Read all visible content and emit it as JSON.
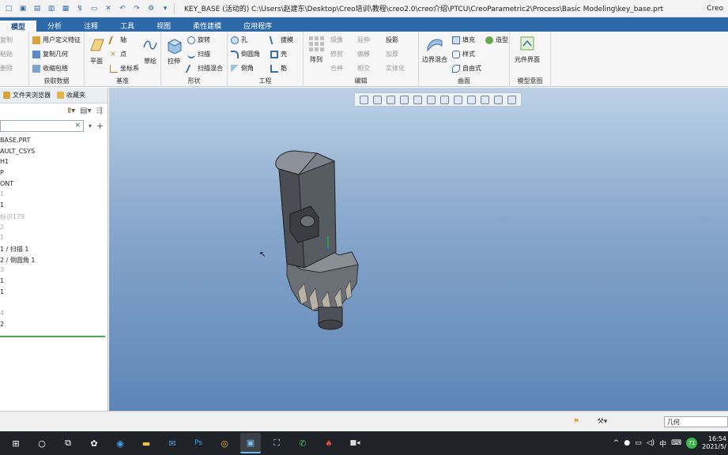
{
  "window": {
    "title": "KEY_BASE (活动的) C:\\Users\\赵建东\\Desktop\\Creo培训\\教程\\creo2.0\\creo介绍\\PTCU\\CreoParametric2\\Process\\Basic Modeling\\key_base.prt",
    "app_name": "Creo"
  },
  "tabs": [
    {
      "label": "模型",
      "active": true
    },
    {
      "label": "分析",
      "active": false
    },
    {
      "label": "注释",
      "active": false
    },
    {
      "label": "工具",
      "active": false
    },
    {
      "label": "视图",
      "active": false
    },
    {
      "label": "柔性建模",
      "active": false
    },
    {
      "label": "应用程序",
      "active": false
    }
  ],
  "ribbon": {
    "ops": {
      "copy": "复制",
      "paste": "粘贴",
      "delete": "删除"
    },
    "get_data": {
      "udf": "用户定义特征",
      "copy_geom": "复制几何",
      "shrinkwrap": "收缩包络",
      "title": "获取数据"
    },
    "datum": {
      "plane": "平面",
      "axis": "轴",
      "point": "点",
      "csys": "坐标系",
      "sketch": "草绘",
      "title": "基准"
    },
    "shapes": {
      "extrude": "拉伸",
      "revolve": "旋转",
      "sweep": "扫描",
      "swept_blend": "扫描混合",
      "title": "形状"
    },
    "engineering": {
      "hole": "孔",
      "round": "倒圆角",
      "chamfer": "倒角",
      "draft": "拔模",
      "shell": "壳",
      "rib": "筋",
      "title": "工程"
    },
    "editing": {
      "pattern": "阵列",
      "mirror": "镜像",
      "trim": "修剪",
      "merge": "合并",
      "extend": "延伸",
      "offset": "偏移",
      "intersect": "相交",
      "project": "投影",
      "thicken": "加厚",
      "solidify": "实体化",
      "title": "编辑"
    },
    "surfaces": {
      "boundary_blend": "边界混合",
      "fill": "填充",
      "style": "样式",
      "freestyle": "自由式",
      "title": "曲面"
    },
    "model_intent": {
      "component_interface": "元件界面",
      "title": "模型意图"
    }
  },
  "left_panel": {
    "tab_browser": "文件夹浏览器",
    "tab_favorites": "收藏夹",
    "tree": [
      {
        "text": "BASE.PRT",
        "dim": false
      },
      {
        "text": "AULT_CSYS",
        "dim": false
      },
      {
        "text": "H1",
        "dim": false
      },
      {
        "text": "P",
        "dim": false
      },
      {
        "text": "ONT",
        "dim": false
      },
      {
        "text": "1",
        "dim": true
      },
      {
        "text": "1",
        "dim": false
      },
      {
        "text": "标识179",
        "dim": true
      },
      {
        "text": "2",
        "dim": true
      },
      {
        "text": "1",
        "dim": true
      },
      {
        "text": "1 / 扫描 1",
        "dim": false
      },
      {
        "text": "2 / 倒圆角 1",
        "dim": false
      },
      {
        "text": "3",
        "dim": true
      },
      {
        "text": "1",
        "dim": false
      },
      {
        "text": "1",
        "dim": false
      },
      {
        "text": "",
        "dim": false
      },
      {
        "text": "4",
        "dim": true
      },
      {
        "text": "2",
        "dim": false
      }
    ]
  },
  "status": {
    "filter_value": "几何"
  },
  "taskbar": {
    "time": "16:54",
    "date": "2021/5/",
    "lang": "中",
    "badge": "71"
  }
}
